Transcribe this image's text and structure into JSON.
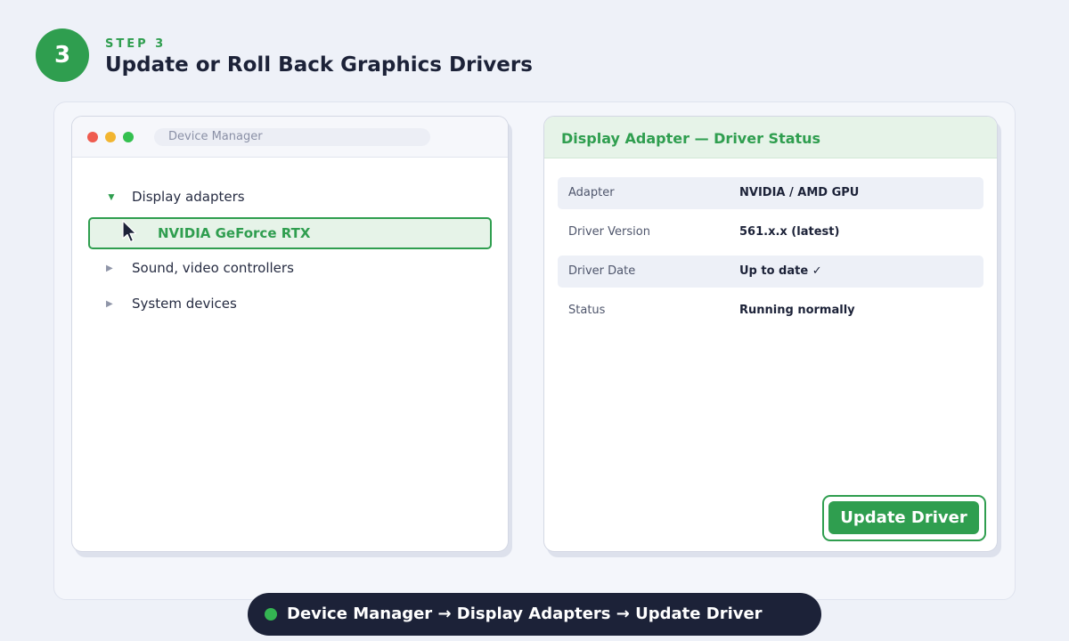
{
  "header": {
    "step_number": "3",
    "step_label": "STEP 3",
    "title": "Update or Roll Back Graphics Drivers"
  },
  "device_manager": {
    "window_title": "Device Manager",
    "tree": [
      {
        "label": "Display adapters",
        "expanded": true
      },
      {
        "label": "NVIDIA GeForce RTX",
        "selected": true,
        "child": true
      },
      {
        "label": "Sound, video controllers",
        "expanded": false
      },
      {
        "label": "System devices",
        "expanded": false
      }
    ]
  },
  "driver_panel": {
    "title": "Display Adapter — Driver Status",
    "rows": [
      {
        "key": "Adapter",
        "value": "NVIDIA / AMD GPU"
      },
      {
        "key": "Driver Version",
        "value": "561.x.x (latest)"
      },
      {
        "key": "Driver Date",
        "value": "Up to date ✓"
      },
      {
        "key": "Status",
        "value": "Running normally"
      }
    ],
    "update_button": "Update Driver"
  },
  "footer": {
    "path": "Device Manager → Display Adapters → Update Driver"
  },
  "colors": {
    "accent": "#2f9e4f",
    "dark": "#1c2238",
    "background": "#eef1f8"
  }
}
